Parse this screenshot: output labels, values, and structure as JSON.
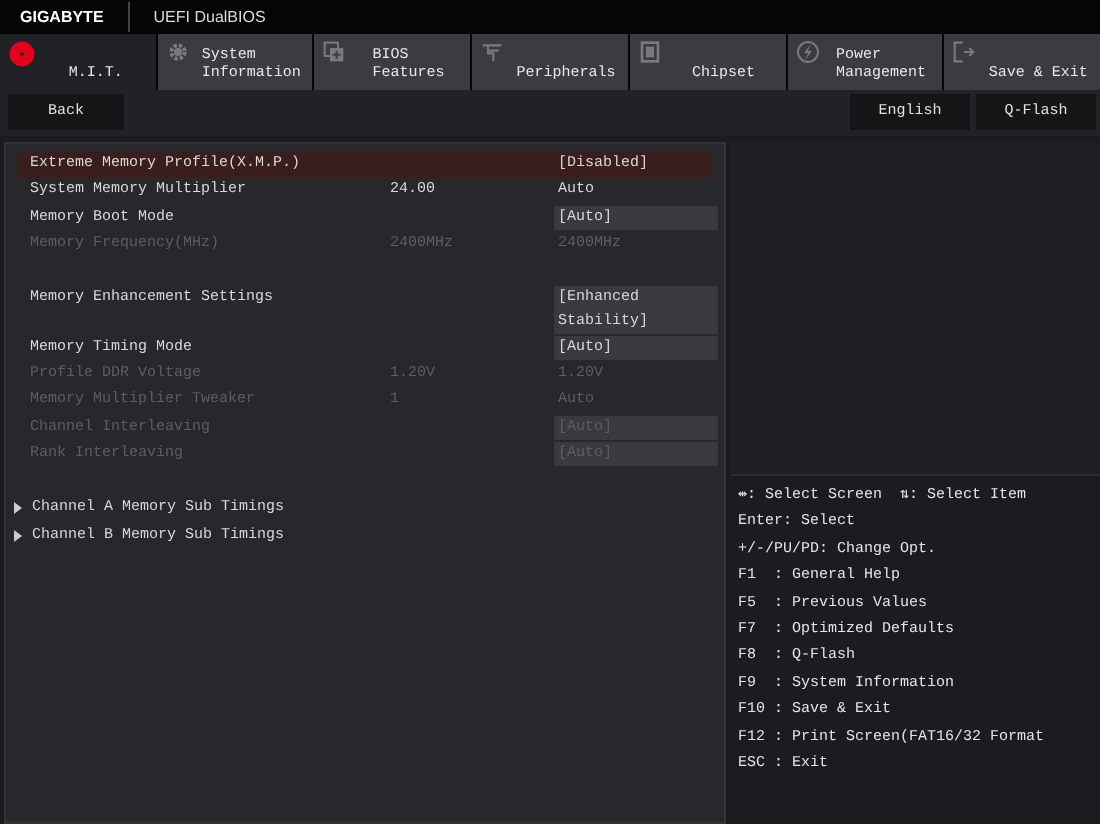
{
  "header": {
    "brand": "GIGABYTE",
    "product": "UEFI DualBIOS"
  },
  "tabs": [
    {
      "label": "M.I.T.",
      "selected": true
    },
    {
      "label": "System\nInformation",
      "selected": false
    },
    {
      "label": "BIOS\nFeatures",
      "selected": false
    },
    {
      "label": "Peripherals",
      "selected": false
    },
    {
      "label": "Chipset",
      "selected": false
    },
    {
      "label": "Power\nManagement",
      "selected": false
    },
    {
      "label": "Save & Exit",
      "selected": false
    }
  ],
  "toolbar": {
    "back": "Back",
    "buttons": [
      "English",
      "Q-Flash"
    ]
  },
  "settings": [
    [
      {
        "label": "Extreme Memory Profile(X.M.P.)",
        "option": "[Disabled]",
        "boxed": true,
        "disabled": false,
        "selected": true
      },
      {
        "label": "System Memory Multiplier",
        "value": "24.00",
        "option": "Auto",
        "boxed": false,
        "disabled": false,
        "selected": false
      },
      {
        "label": "Memory Boot Mode",
        "option": "[Auto]",
        "boxed": true,
        "disabled": false,
        "selected": false
      },
      {
        "label": "Memory Frequency(MHz)",
        "value": "2400MHz",
        "option": "2400MHz",
        "boxed": false,
        "disabled": true,
        "selected": false
      }
    ],
    [
      {
        "label": "Memory Enhancement Settings",
        "option": "[Enhanced\nStability]",
        "boxed": true,
        "disabled": false,
        "selected": false
      },
      {
        "label": "Memory Timing Mode",
        "option": "[Auto]",
        "boxed": true,
        "disabled": false,
        "selected": false
      },
      {
        "label": "Profile DDR Voltage",
        "value": "1.20V",
        "option": "1.20V",
        "boxed": false,
        "disabled": true,
        "selected": false
      },
      {
        "label": "Memory Multiplier Tweaker",
        "value": "1",
        "option": "Auto",
        "boxed": false,
        "disabled": true,
        "selected": false
      },
      {
        "label": "Channel Interleaving",
        "option": "[Auto]",
        "boxed": true,
        "disabled": true,
        "selected": false
      },
      {
        "label": "Rank Interleaving",
        "option": "[Auto]",
        "boxed": true,
        "disabled": true,
        "selected": false
      }
    ]
  ],
  "submenus": [
    "Channel A Memory Sub Timings",
    "Channel B Memory Sub Timings"
  ],
  "help": [
    "⇹: Select Screen  ⇅: Select Item",
    "Enter: Select",
    "+/-/PU/PD: Change Opt.",
    "F1  : General Help",
    "F5  : Previous Values",
    "F7  : Optimized Defaults",
    "F8  : Q-Flash",
    "F9  : System Information",
    "F10 : Save & Exit",
    "F12 : Print Screen(FAT16/32 Format",
    "ESC : Exit"
  ]
}
